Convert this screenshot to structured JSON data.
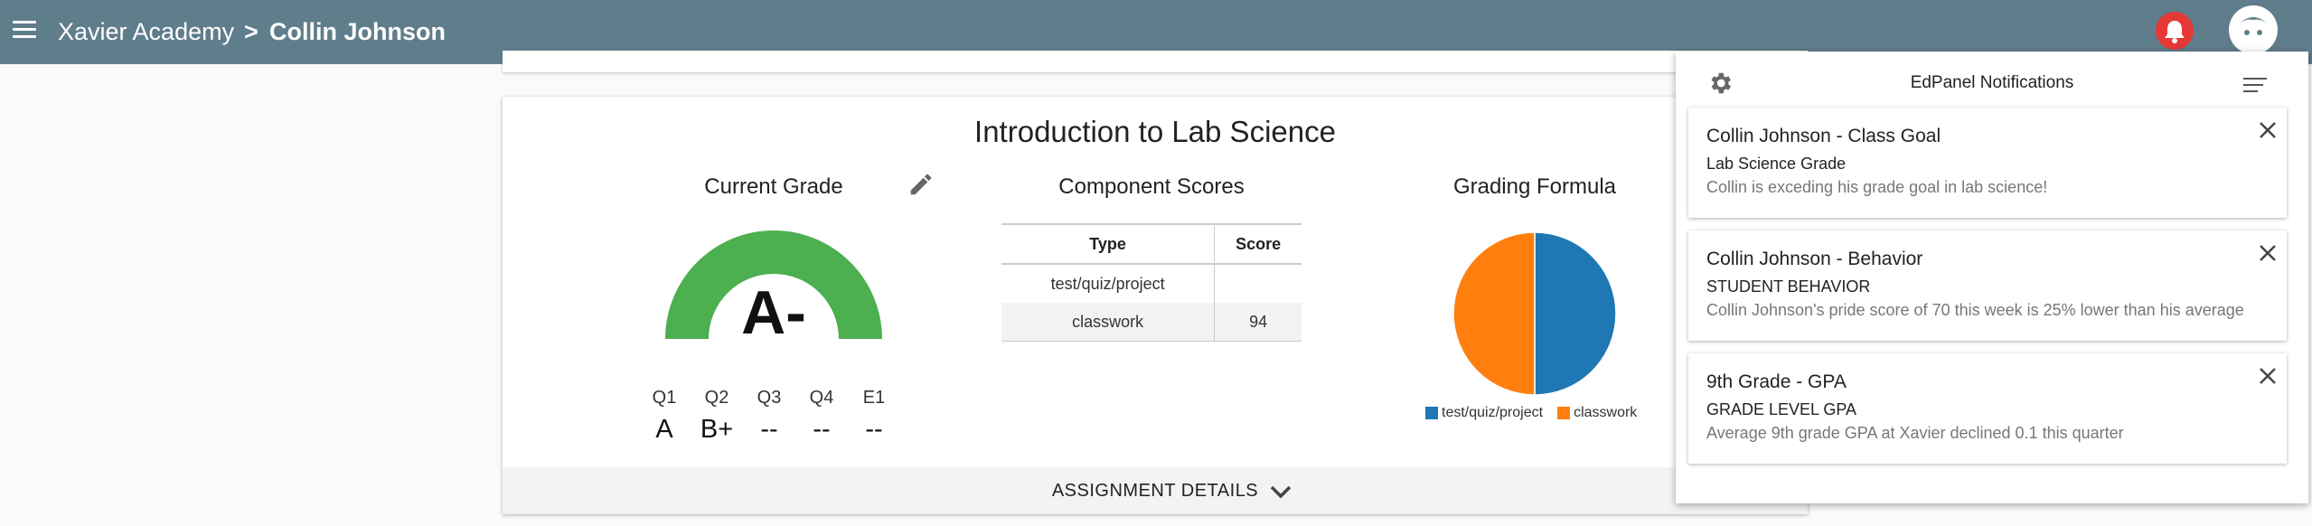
{
  "header": {
    "school": "Xavier Academy",
    "separator": ">",
    "student": "Collin Johnson",
    "icons": [
      "menu-icon",
      "bell-icon",
      "avatar-icon"
    ],
    "bar_color": "#607d8b"
  },
  "course": {
    "title": "Introduction to Lab Science",
    "current_grade": {
      "heading": "Current Grade",
      "letter": "A-",
      "gauge_color": "#4caf50",
      "quarters": [
        {
          "label": "Q1",
          "value": "A"
        },
        {
          "label": "Q2",
          "value": "B+"
        },
        {
          "label": "Q3",
          "value": "--"
        },
        {
          "label": "Q4",
          "value": "--"
        },
        {
          "label": "E1",
          "value": "--"
        }
      ]
    },
    "component_scores": {
      "heading": "Component Scores",
      "columns": [
        "Type",
        "Score"
      ],
      "rows": [
        {
          "type": "test/quiz/project",
          "score": ""
        },
        {
          "type": "classwork",
          "score": "94"
        }
      ]
    },
    "grading_formula": {
      "heading": "Grading Formula",
      "slices": [
        {
          "label": "test/quiz/project",
          "value": 50,
          "color": "#1f77b4"
        },
        {
          "label": "classwork",
          "value": 50,
          "color": "#ff7f0e"
        }
      ]
    },
    "assignment_details_label": "ASSIGNMENT DETAILS"
  },
  "notifications": {
    "title": "EdPanel Notifications",
    "items": [
      {
        "title": "Collin Johnson - Class Goal",
        "subtitle": "Lab Science Grade",
        "body": "Collin is exceding his grade goal in lab science!"
      },
      {
        "title": "Collin Johnson - Behavior",
        "subtitle": "STUDENT BEHAVIOR",
        "body": "Collin Johnson's pride score of 70 this week is 25% lower than his average"
      },
      {
        "title": "9th Grade - GPA",
        "subtitle": "GRADE LEVEL GPA",
        "body": "Average 9th grade GPA at Xavier declined 0.1 this quarter"
      }
    ]
  }
}
